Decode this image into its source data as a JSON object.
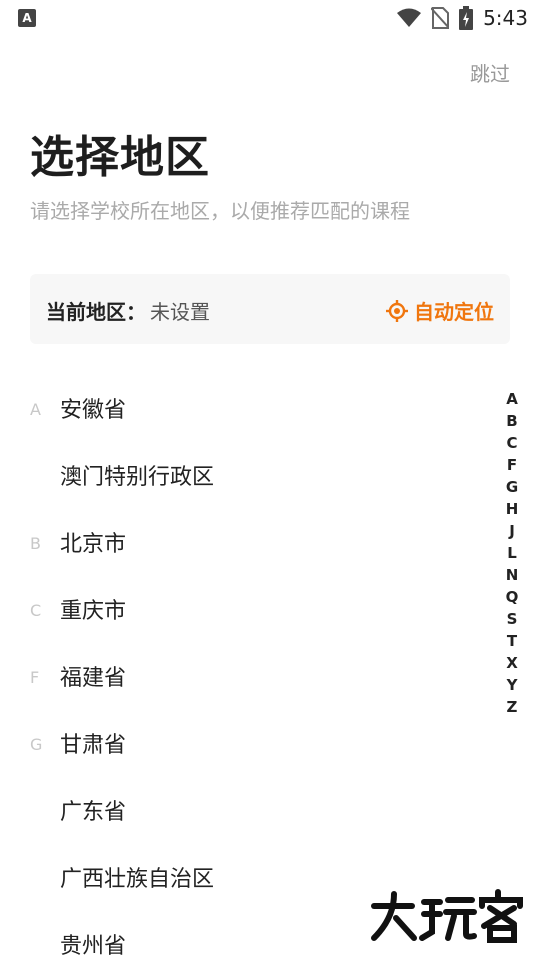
{
  "status_bar": {
    "app_icon_letter": "A",
    "time": "5:43"
  },
  "header": {
    "skip_label": "跳过",
    "title": "选择地区",
    "subtitle": "请选择学校所在地区，以便推荐匹配的课程"
  },
  "current_region": {
    "label": "当前地区：",
    "value": "未设置",
    "locate_label": "自动定位"
  },
  "regions": [
    {
      "letter": "A",
      "name": "安徽省"
    },
    {
      "letter": "",
      "name": "澳门特别行政区"
    },
    {
      "letter": "B",
      "name": "北京市"
    },
    {
      "letter": "C",
      "name": "重庆市"
    },
    {
      "letter": "F",
      "name": "福建省"
    },
    {
      "letter": "G",
      "name": "甘肃省"
    },
    {
      "letter": "",
      "name": "广东省"
    },
    {
      "letter": "",
      "name": "广西壮族自治区"
    },
    {
      "letter": "",
      "name": "贵州省"
    }
  ],
  "index_letters": [
    "A",
    "B",
    "C",
    "F",
    "G",
    "H",
    "J",
    "L",
    "N",
    "Q",
    "S",
    "T",
    "X",
    "Y",
    "Z"
  ],
  "colors": {
    "accent": "#f0760e",
    "text": "#222222",
    "muted": "#999999"
  },
  "watermark": {
    "text": "大玩客"
  }
}
